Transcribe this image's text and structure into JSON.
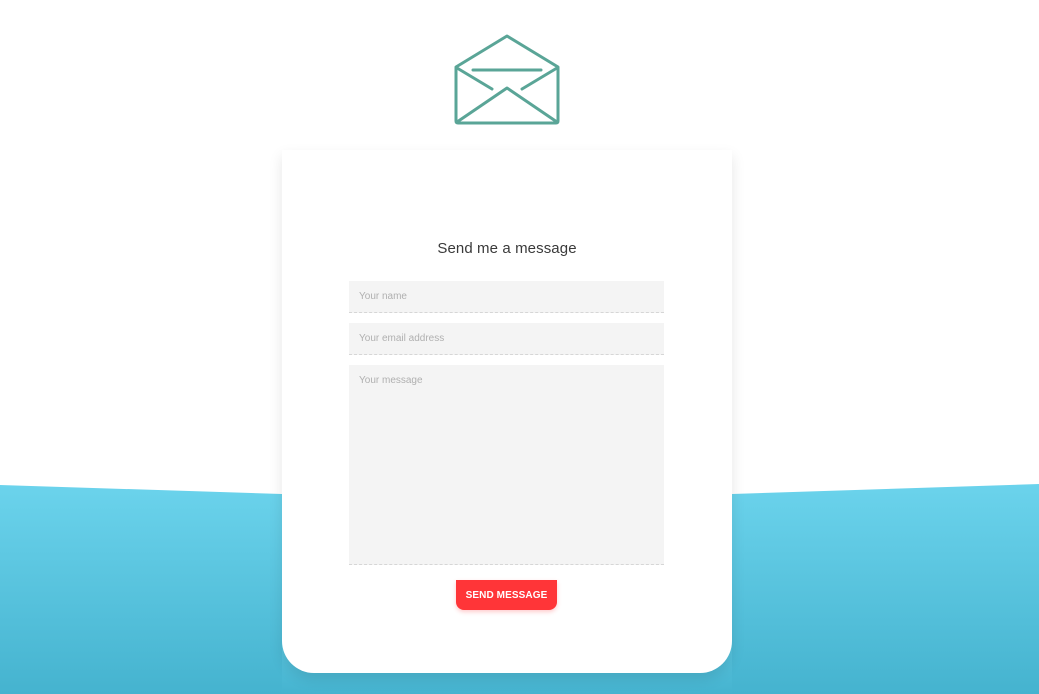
{
  "contact_form": {
    "heading": "Send me a message",
    "name_placeholder": "Your name",
    "email_placeholder": "Your email address",
    "message_placeholder": "Your message",
    "send_label": "SEND MESSAGE"
  },
  "icons": {
    "envelope": "envelope-open-icon"
  },
  "colors": {
    "accent": "#ff3538",
    "icon_teal": "#5aa597",
    "wave_top": "#6bd3ec",
    "wave_bottom": "#45b3cf",
    "field_bg": "#f4f4f4"
  }
}
